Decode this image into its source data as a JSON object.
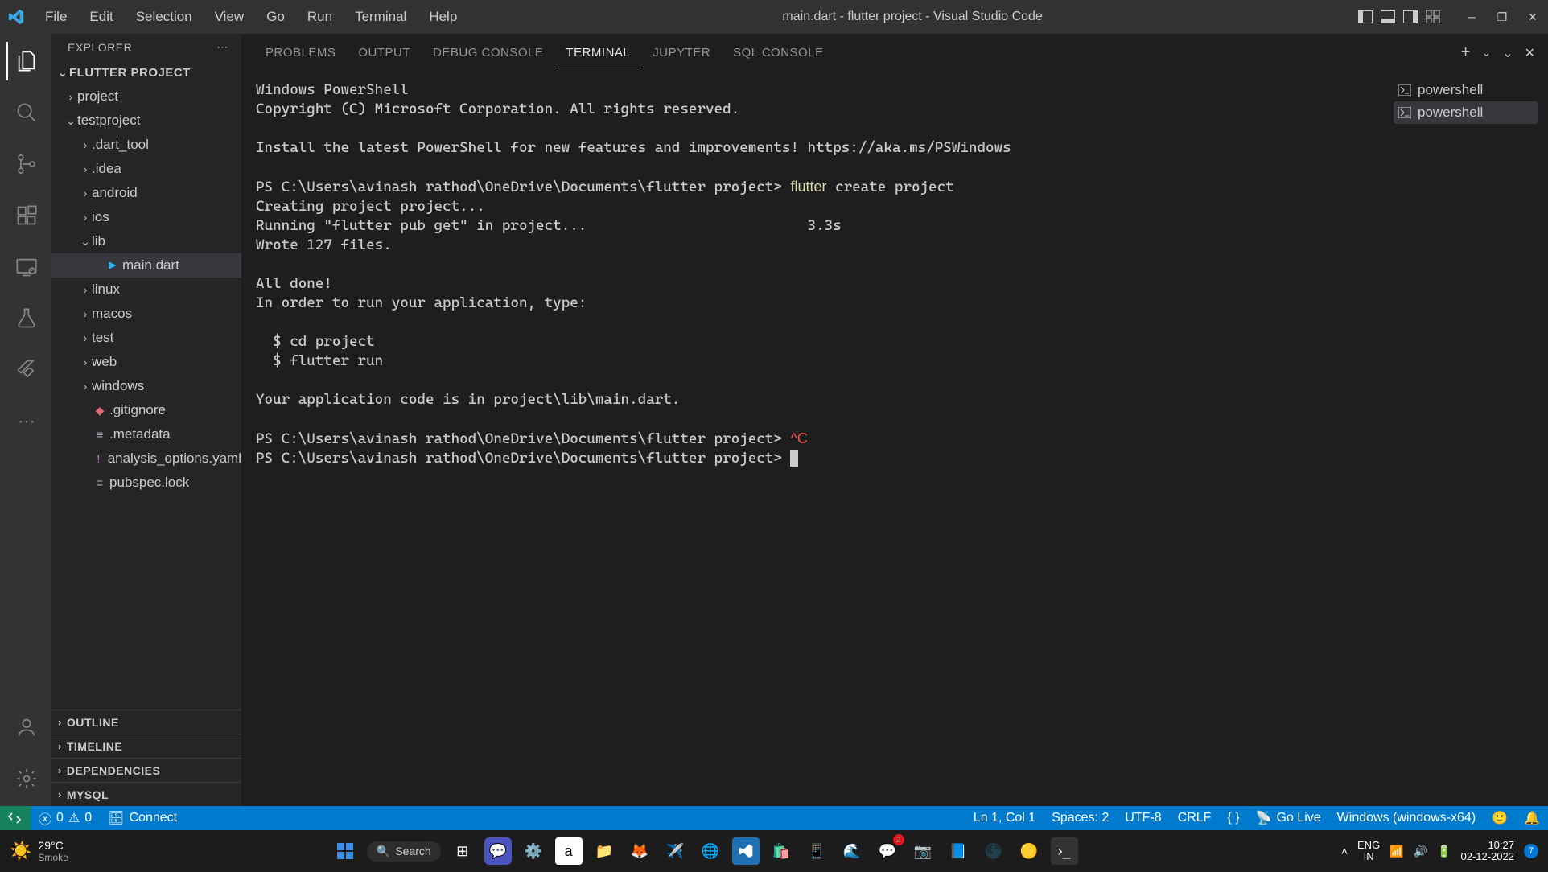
{
  "titlebar": {
    "menu": [
      "File",
      "Edit",
      "Selection",
      "View",
      "Go",
      "Run",
      "Terminal",
      "Help"
    ],
    "title": "main.dart - flutter project - Visual Studio Code"
  },
  "sidebar": {
    "header": "EXPLORER",
    "project_root": "FLUTTER PROJECT",
    "tree": [
      {
        "label": "project",
        "chev": "›",
        "indent": 16,
        "icon": ""
      },
      {
        "label": "testproject",
        "chev": "⌄",
        "indent": 16,
        "icon": ""
      },
      {
        "label": ".dart_tool",
        "chev": "›",
        "indent": 34,
        "icon": ""
      },
      {
        "label": ".idea",
        "chev": "›",
        "indent": 34,
        "icon": ""
      },
      {
        "label": "android",
        "chev": "›",
        "indent": 34,
        "icon": ""
      },
      {
        "label": "ios",
        "chev": "›",
        "indent": 34,
        "icon": ""
      },
      {
        "label": "lib",
        "chev": "⌄",
        "indent": 34,
        "icon": ""
      },
      {
        "label": "main.dart",
        "chev": "",
        "indent": 50,
        "icon": "dart",
        "selected": true
      },
      {
        "label": "linux",
        "chev": "›",
        "indent": 34,
        "icon": ""
      },
      {
        "label": "macos",
        "chev": "›",
        "indent": 34,
        "icon": ""
      },
      {
        "label": "test",
        "chev": "›",
        "indent": 34,
        "icon": ""
      },
      {
        "label": "web",
        "chev": "›",
        "indent": 34,
        "icon": ""
      },
      {
        "label": "windows",
        "chev": "›",
        "indent": 34,
        "icon": ""
      },
      {
        "label": ".gitignore",
        "chev": "",
        "indent": 34,
        "icon": "git"
      },
      {
        "label": ".metadata",
        "chev": "",
        "indent": 34,
        "icon": "meta"
      },
      {
        "label": "analysis_options.yaml",
        "chev": "",
        "indent": 34,
        "icon": "yaml"
      },
      {
        "label": "pubspec.lock",
        "chev": "",
        "indent": 34,
        "icon": "lock"
      }
    ],
    "sections": [
      "OUTLINE",
      "TIMELINE",
      "DEPENDENCIES",
      "MYSQL"
    ]
  },
  "panel": {
    "tabs": [
      "PROBLEMS",
      "OUTPUT",
      "DEBUG CONSOLE",
      "TERMINAL",
      "JUPYTER",
      "SQL CONSOLE"
    ],
    "active_tab": "TERMINAL",
    "shells": [
      "powershell",
      "powershell"
    ]
  },
  "terminal": {
    "lines": [
      {
        "t": "Windows PowerShell"
      },
      {
        "t": "Copyright (C) Microsoft Corporation. All rights reserved."
      },
      {
        "t": ""
      },
      {
        "t": "Install the latest PowerShell for new features and improvements! https://aka.ms/PSWindows"
      },
      {
        "t": ""
      },
      {
        "prompt": "PS C:\\Users\\avinash rathod\\OneDrive\\Documents\\flutter project> ",
        "cmd_yellow": "flutter",
        "cmd_rest": " create project"
      },
      {
        "t": "Creating project project..."
      },
      {
        "t": "Running \"flutter pub get\" in project...                          3.3s"
      },
      {
        "t": "Wrote 127 files."
      },
      {
        "t": ""
      },
      {
        "t": "All done!"
      },
      {
        "t": "In order to run your application, type:"
      },
      {
        "t": ""
      },
      {
        "t": "  $ cd project"
      },
      {
        "t": "  $ flutter run"
      },
      {
        "t": ""
      },
      {
        "t": "Your application code is in project\\lib\\main.dart."
      },
      {
        "t": ""
      },
      {
        "prompt": "PS C:\\Users\\avinash rathod\\OneDrive\\Documents\\flutter project> ",
        "red": "^C"
      },
      {
        "prompt": "PS C:\\Users\\avinash rathod\\OneDrive\\Documents\\flutter project> ",
        "cursor": true
      }
    ]
  },
  "statusbar": {
    "errors": "0",
    "warnings": "0",
    "connect": "Connect",
    "ln_col": "Ln 1, Col 1",
    "spaces": "Spaces: 2",
    "encoding": "UTF-8",
    "eol": "CRLF",
    "braces": "{ }",
    "golive": "Go Live",
    "platform": "Windows (windows-x64)"
  },
  "taskbar": {
    "weather_temp": "29°C",
    "weather_desc": "Smoke",
    "search": "Search",
    "lang1": "ENG",
    "lang2": "IN",
    "time": "10:27",
    "date": "02-12-2022",
    "notif": "7"
  }
}
